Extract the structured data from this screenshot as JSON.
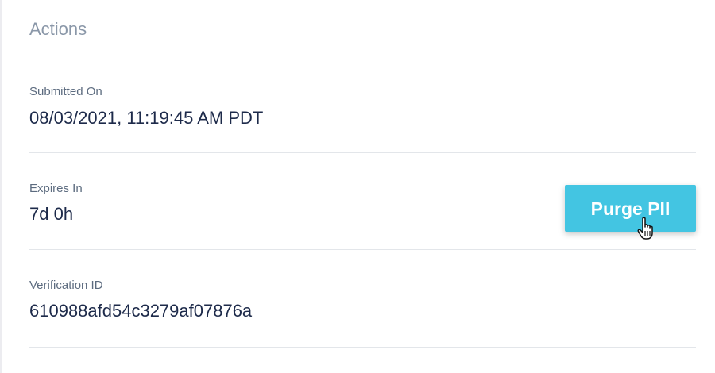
{
  "section": {
    "title": "Actions"
  },
  "fields": {
    "submitted_on": {
      "label": "Submitted On",
      "value": "08/03/2021, 11:19:45 AM PDT"
    },
    "expires_in": {
      "label": "Expires In",
      "value": "7d 0h"
    },
    "verification_id": {
      "label": "Verification ID",
      "value": "610988afd54c3279af07876a"
    }
  },
  "buttons": {
    "purge_pii": {
      "label": "Purge PII",
      "color": "#43c5e2"
    }
  },
  "cursor": {
    "icon": "hand-pointer-icon"
  }
}
